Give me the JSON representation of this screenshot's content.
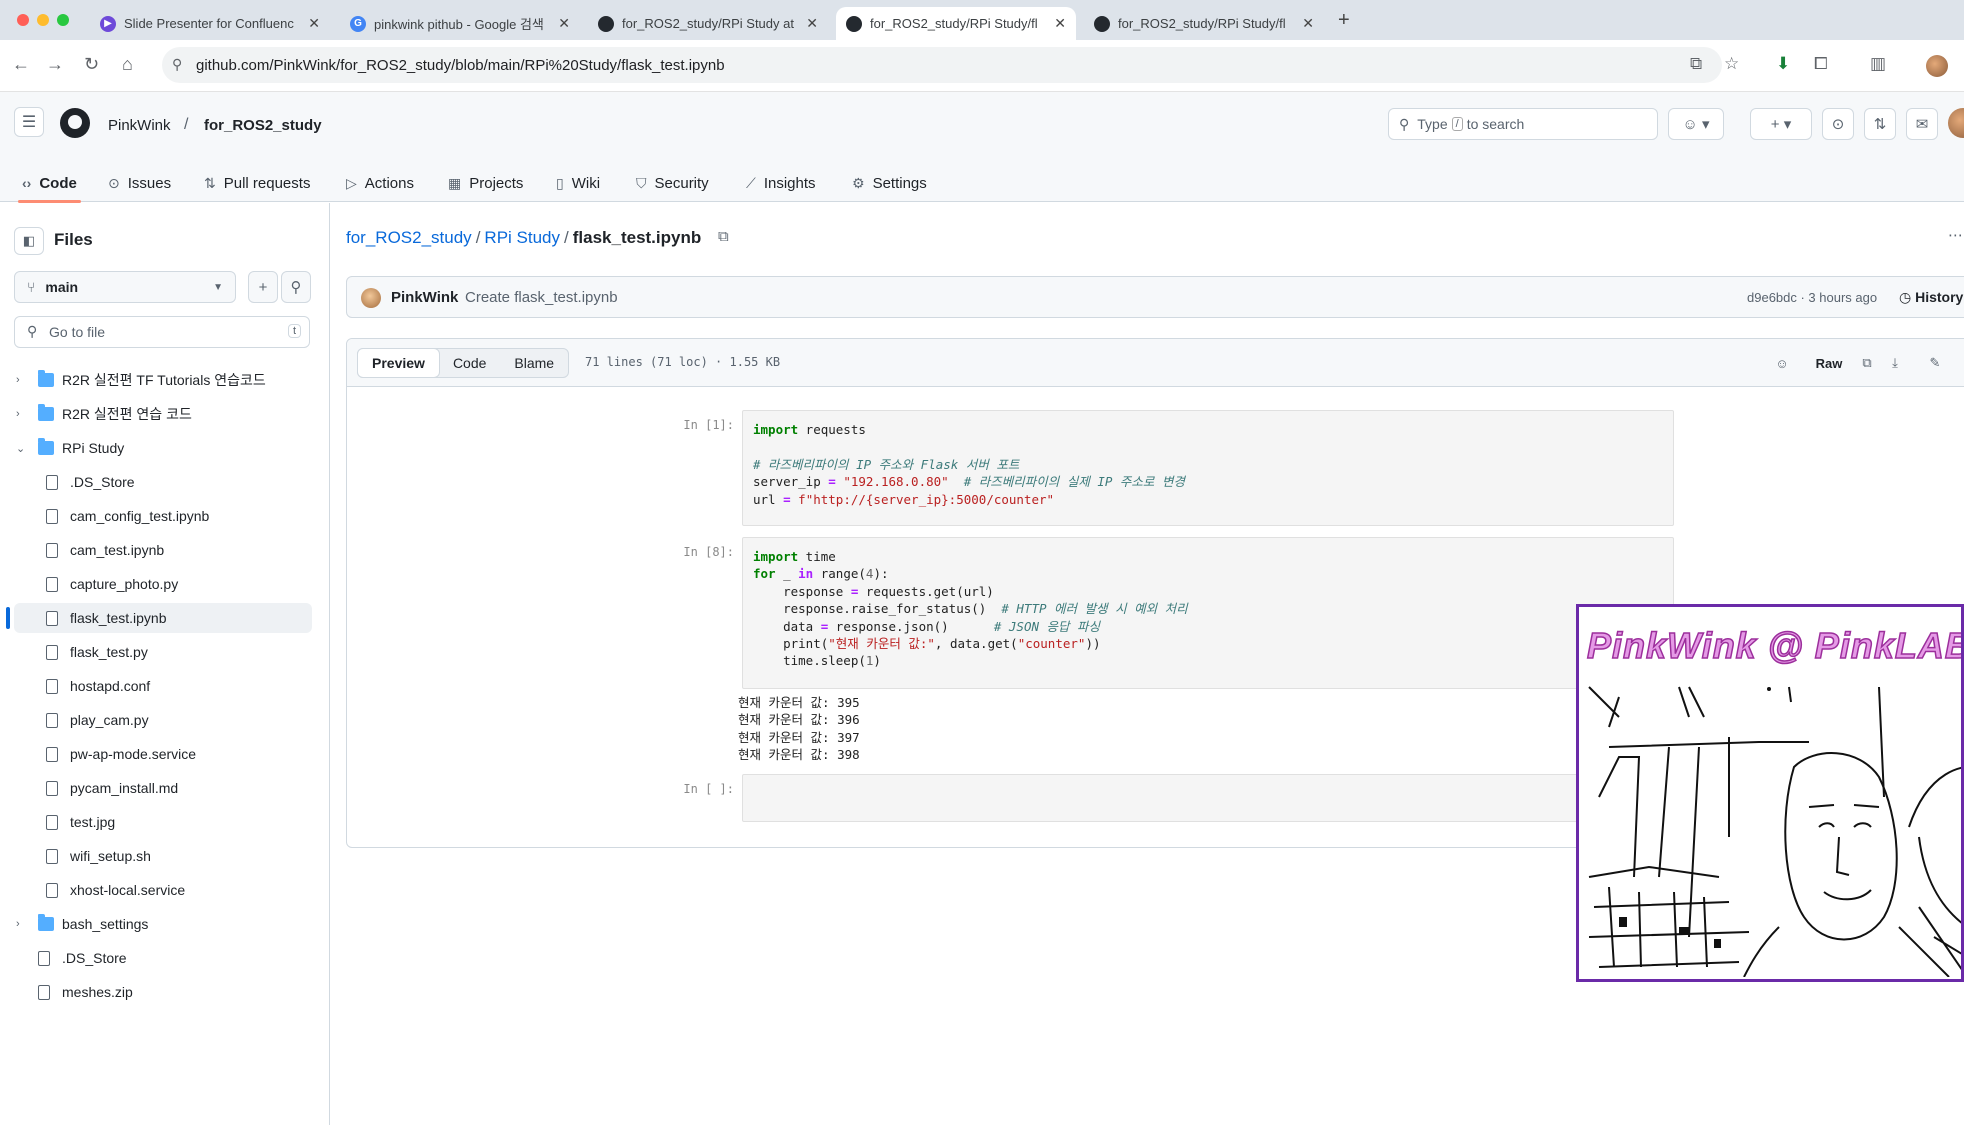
{
  "browser": {
    "tabs": [
      {
        "title": "Slide Presenter for Confluenc",
        "favicon": "slide-presenter-icon",
        "color": "#6e4ad9"
      },
      {
        "title": "pinkwink pithub - Google 검색",
        "favicon": "google-icon",
        "color": "#4285f4"
      },
      {
        "title": "for_ROS2_study/RPi Study at",
        "favicon": "github-icon",
        "color": "#24292f"
      },
      {
        "title": "for_ROS2_study/RPi Study/fl",
        "favicon": "github-icon",
        "color": "#24292f",
        "active": true
      },
      {
        "title": "for_ROS2_study/RPi Study/fl",
        "favicon": "github-icon",
        "color": "#24292f"
      }
    ],
    "url": "github.com/PinkWink/for_ROS2_study/blob/main/RPi%20Study/flask_test.ipynb"
  },
  "header": {
    "owner": "PinkWink",
    "separator": "/",
    "repo": "for_ROS2_study",
    "search_prefix": "Type",
    "search_key": "/",
    "search_suffix": "to search"
  },
  "repo_nav": [
    {
      "label": "Code",
      "icon": "code-icon",
      "glyph": "‹›"
    },
    {
      "label": "Issues",
      "icon": "issues-icon",
      "glyph": "⊙"
    },
    {
      "label": "Pull requests",
      "icon": "pull-request-icon",
      "glyph": "⇅"
    },
    {
      "label": "Actions",
      "icon": "actions-icon",
      "glyph": "▷"
    },
    {
      "label": "Projects",
      "icon": "projects-icon",
      "glyph": "▦"
    },
    {
      "label": "Wiki",
      "icon": "wiki-icon",
      "glyph": "▯"
    },
    {
      "label": "Security",
      "icon": "shield-icon",
      "glyph": "⛉"
    },
    {
      "label": "Insights",
      "icon": "graph-icon",
      "glyph": "⟋"
    },
    {
      "label": "Settings",
      "icon": "gear-icon",
      "glyph": "⚙"
    }
  ],
  "sidebar": {
    "title": "Files",
    "branch": "main",
    "goto_placeholder": "Go to file",
    "goto_key": "t",
    "tree": [
      {
        "label": "R2R 실전편 TF Tutorials 연습코드",
        "type": "folder",
        "level": 0,
        "expanded": false
      },
      {
        "label": "R2R 실전편 연습 코드",
        "type": "folder",
        "level": 0,
        "expanded": false
      },
      {
        "label": "RPi Study",
        "type": "folder",
        "level": 0,
        "expanded": true
      },
      {
        "label": ".DS_Store",
        "type": "file",
        "level": 1
      },
      {
        "label": "cam_config_test.ipynb",
        "type": "file",
        "level": 1
      },
      {
        "label": "cam_test.ipynb",
        "type": "file",
        "level": 1
      },
      {
        "label": "capture_photo.py",
        "type": "file",
        "level": 1
      },
      {
        "label": "flask_test.ipynb",
        "type": "file",
        "level": 1,
        "active": true
      },
      {
        "label": "flask_test.py",
        "type": "file",
        "level": 1
      },
      {
        "label": "hostapd.conf",
        "type": "file",
        "level": 1
      },
      {
        "label": "play_cam.py",
        "type": "file",
        "level": 1
      },
      {
        "label": "pw-ap-mode.service",
        "type": "file",
        "level": 1
      },
      {
        "label": "pycam_install.md",
        "type": "file",
        "level": 1
      },
      {
        "label": "test.jpg",
        "type": "file",
        "level": 1
      },
      {
        "label": "wifi_setup.sh",
        "type": "file",
        "level": 1
      },
      {
        "label": "xhost-local.service",
        "type": "file",
        "level": 1
      },
      {
        "label": "bash_settings",
        "type": "folder",
        "level": 0,
        "expanded": false
      },
      {
        "label": ".DS_Store",
        "type": "file",
        "level": 0
      },
      {
        "label": "meshes.zip",
        "type": "file",
        "level": 0
      }
    ]
  },
  "breadcrumb": {
    "repo": "for_ROS2_study",
    "folder": "RPi Study",
    "file": "flask_test.ipynb"
  },
  "commit": {
    "author": "PinkWink",
    "message": "Create flask_test.ipynb",
    "sha_time": "d9e6bdc · 3 hours ago",
    "history": "History"
  },
  "file_header": {
    "tabs": [
      "Preview",
      "Code",
      "Blame"
    ],
    "meta": "71 lines (71 loc) · 1.55 KB",
    "raw": "Raw"
  },
  "notebook": {
    "prompts": [
      "In [1]:",
      "In [8]:",
      "In [ ]:"
    ],
    "outputs": [
      "현재 카운터 값: 395",
      "현재 카운터 값: 396",
      "현재 카운터 값: 397",
      "현재 카운터 값: 398"
    ]
  },
  "cam_overlay": {
    "title": "PinkWink @ PinkLAB"
  }
}
